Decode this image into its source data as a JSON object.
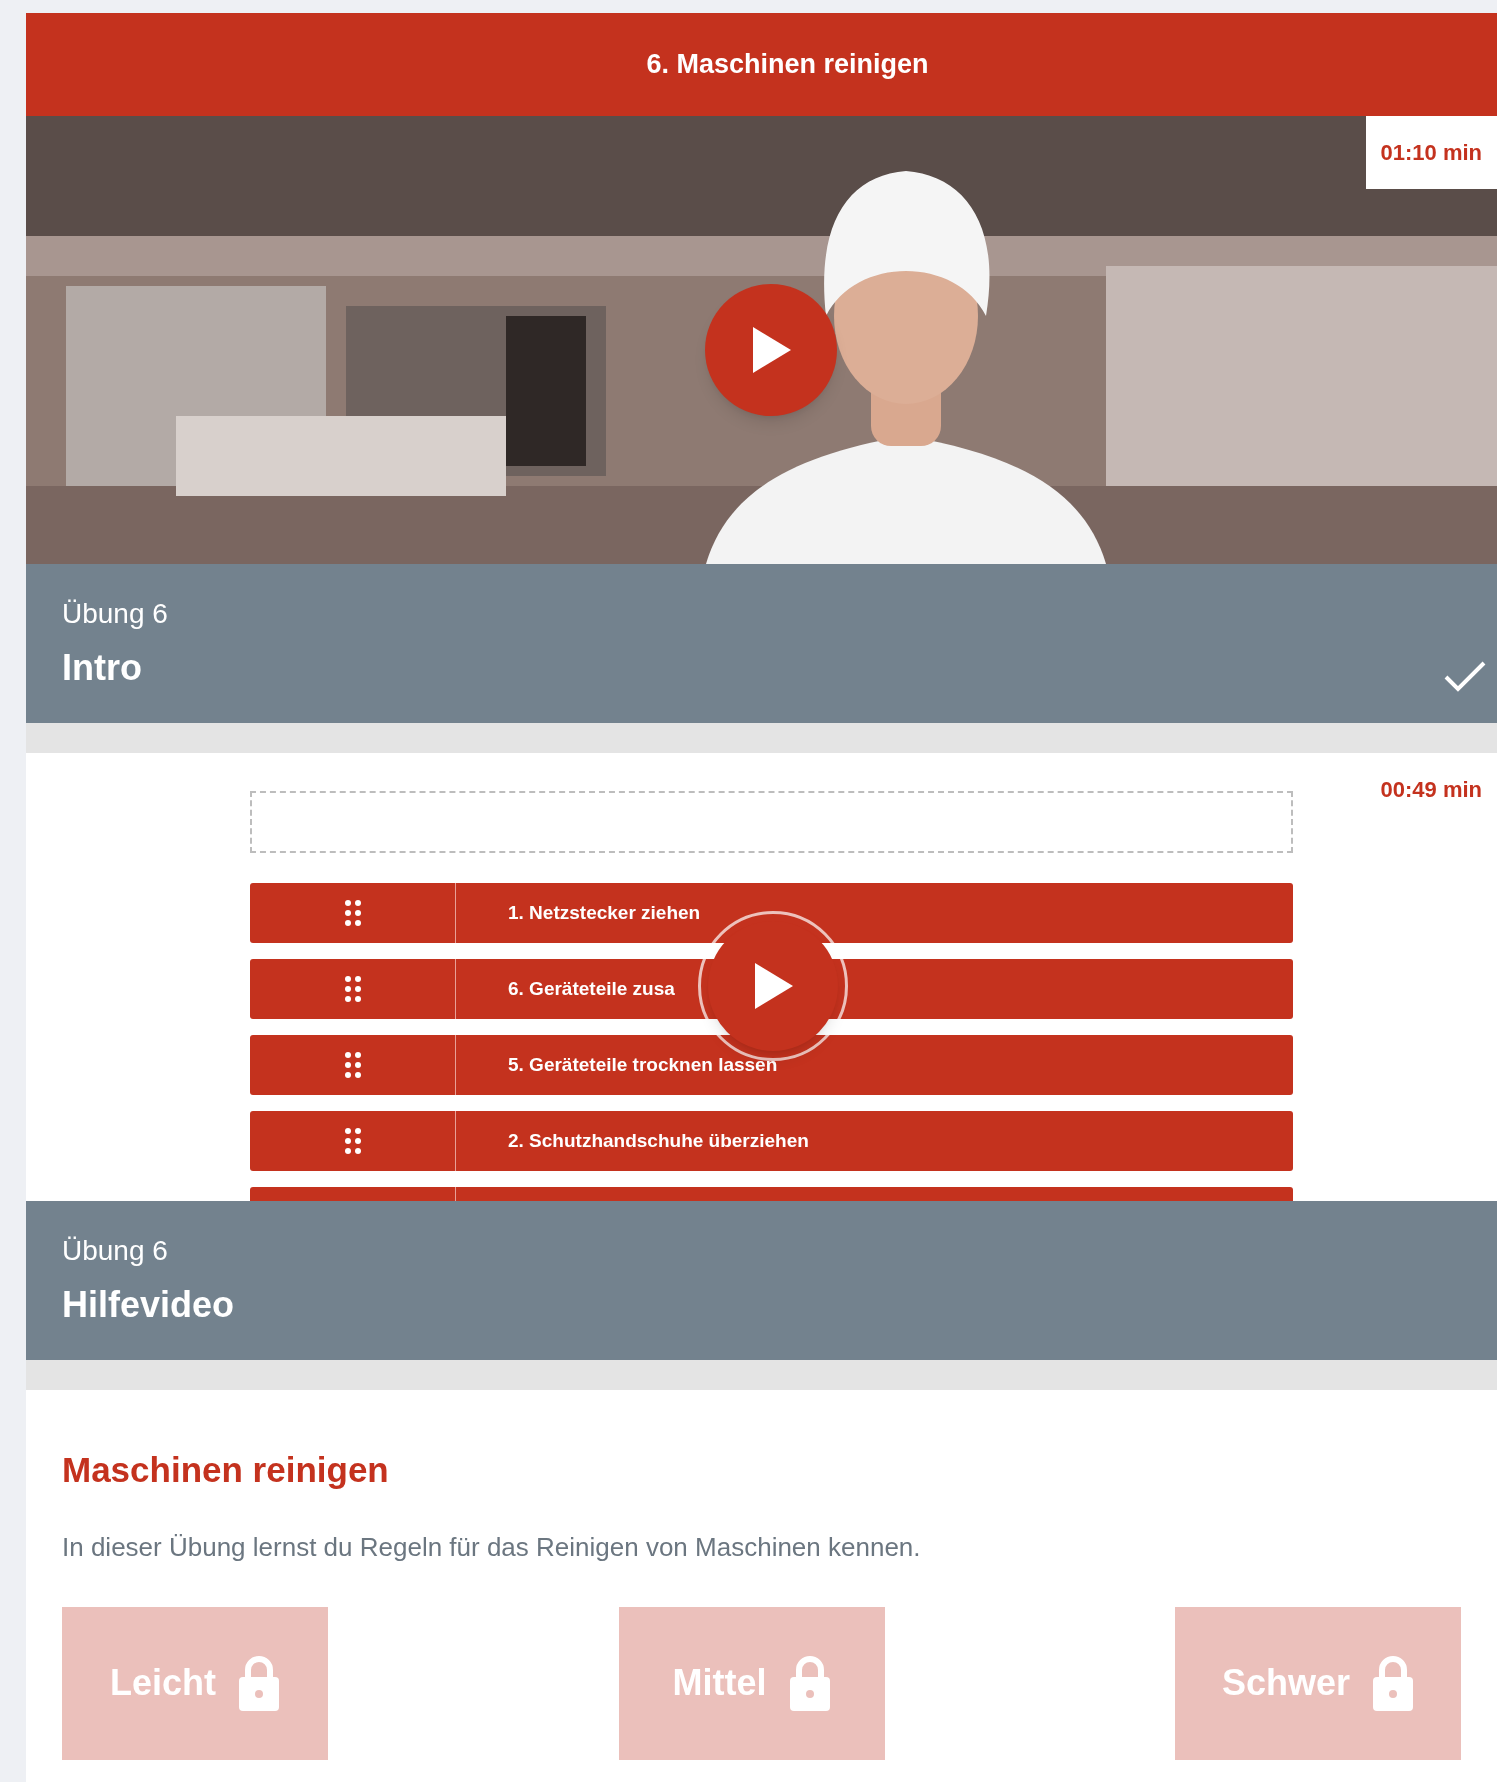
{
  "header": {
    "title": "6. Maschinen reinigen"
  },
  "videos": [
    {
      "kind": "picture",
      "duration": "01:10 min",
      "exercise": "Übung 6",
      "title": "Intro",
      "completed": true
    },
    {
      "kind": "screen",
      "duration": "00:49 min",
      "exercise": "Übung 6",
      "title": "Hilfevideo",
      "completed": false,
      "items": [
        "1. Netzstecker ziehen",
        "6. Geräteteile zusa",
        "5. Geräteteile trocknen lassen",
        "2. Schutzhandschuhe überziehen"
      ]
    }
  ],
  "section": {
    "title": "Maschinen reinigen",
    "description": "In dieser Übung lernst du Regeln für das Reinigen von Maschinen kennen.",
    "levels": [
      {
        "label": "Leicht",
        "locked": true
      },
      {
        "label": "Mittel",
        "locked": true
      },
      {
        "label": "Schwer",
        "locked": true
      }
    ]
  }
}
